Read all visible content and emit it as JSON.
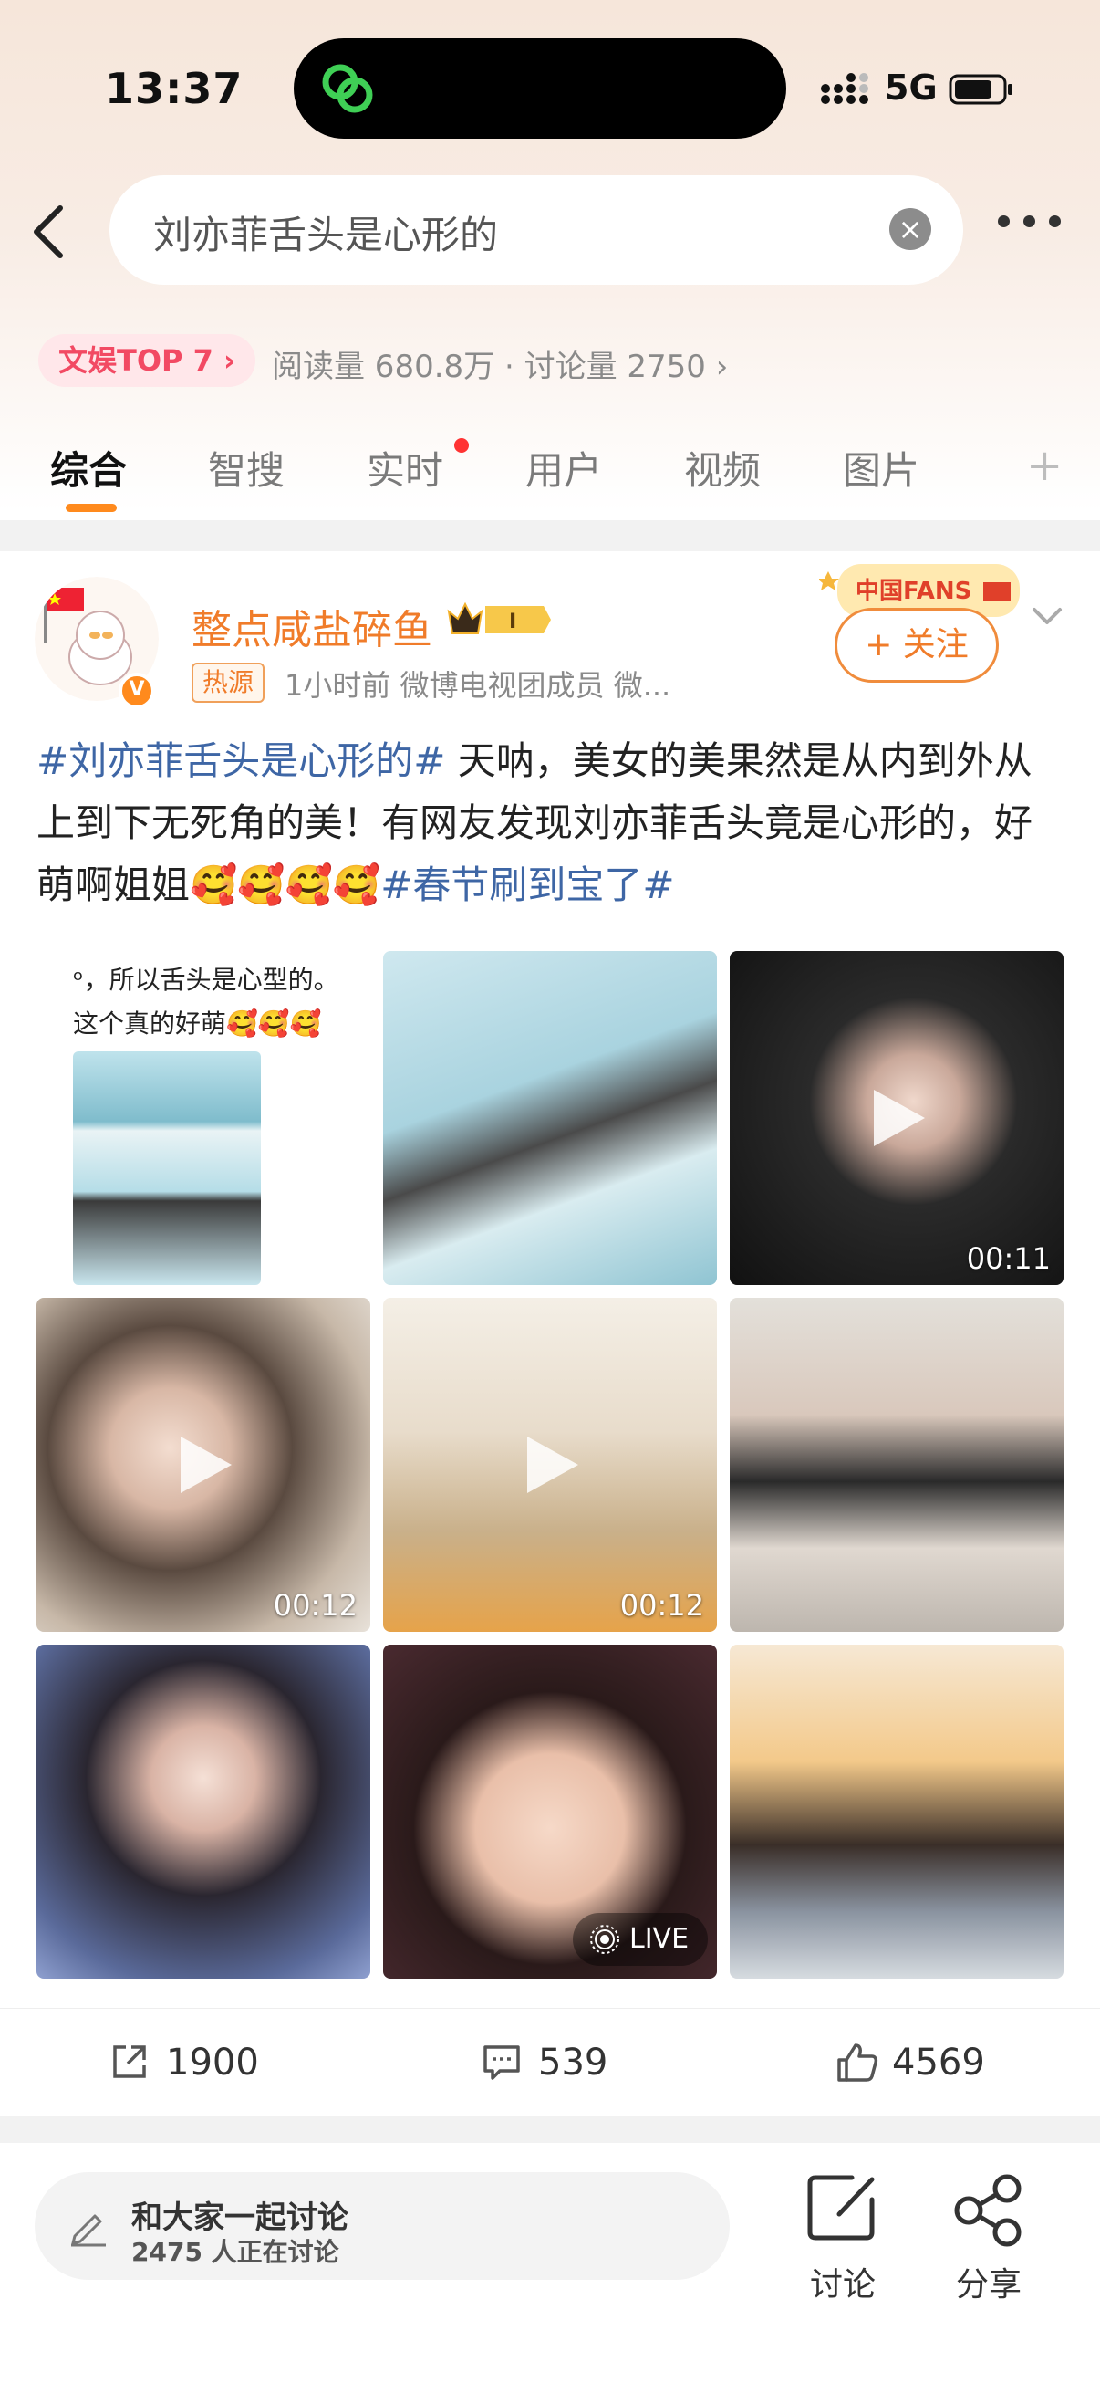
{
  "status": {
    "time": "13:37",
    "network": "5G"
  },
  "search": {
    "query": "刘亦菲舌头是心形的"
  },
  "topic_meta": {
    "rank_badge": "文娱TOP 7 ›",
    "stats": "阅读量 680.8万 · 讨论量 2750 ›"
  },
  "tabs": [
    "综合",
    "智搜",
    "实时",
    "用户",
    "视频",
    "图片"
  ],
  "post": {
    "username": "整点咸盐碎鱼",
    "vip_label": "I",
    "source_tag": "热源",
    "subline": "1小时前  微博电视团成员 微...",
    "fans_badge": "中国FANS",
    "follow_label": "+ 关注",
    "text": {
      "tag1": "#刘亦菲舌头是心形的#",
      "body": " 天呐，美女的美果然是从内到外从上到下无死角的美！有网友发现刘亦菲舌头竟是心形的，好萌啊姐姐",
      "emojis": "🥰🥰🥰🥰",
      "tag2": "#春节刷到宝了#"
    },
    "cell1_caption_line1": "ᵒ，所以舌头是心型的。",
    "cell1_caption_line2": "这个真的好萌🥰🥰🥰",
    "durations": {
      "cell3": "00:11",
      "cell4": "00:12",
      "cell5": "00:12"
    },
    "live_label": "LIVE",
    "actions": {
      "repost": "1900",
      "comments": "539",
      "likes": "4569"
    }
  },
  "discuss": {
    "title": "和大家一起讨论",
    "subtitle": "2475 人正在讨论",
    "discuss_label": "讨论",
    "share_label": "分享"
  },
  "colors": {
    "accent": "#ff8a1d",
    "username": "#f07c2a",
    "hashtag": "#3e66a5",
    "rank_red": "#f24a63"
  }
}
